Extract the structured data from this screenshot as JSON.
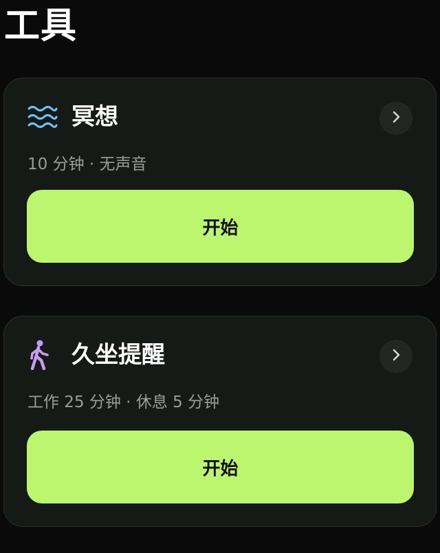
{
  "page": {
    "title": "工具"
  },
  "cards": [
    {
      "icon": "waves-icon",
      "title": "冥想",
      "subtitle": "10 分钟 · 无声音",
      "button_label": "开始"
    },
    {
      "icon": "walking-person-icon",
      "title": "久坐提醒",
      "subtitle": "工作 25 分钟 · 休息 5 分钟",
      "button_label": "开始"
    }
  ],
  "colors": {
    "background": "#0a0a0a",
    "card": "#161a16",
    "accent": "#bcf56e",
    "waves_icon": "#6cc3f5",
    "walker_icon": "#c79cf2",
    "subtitle_text": "#9a9e9a"
  }
}
